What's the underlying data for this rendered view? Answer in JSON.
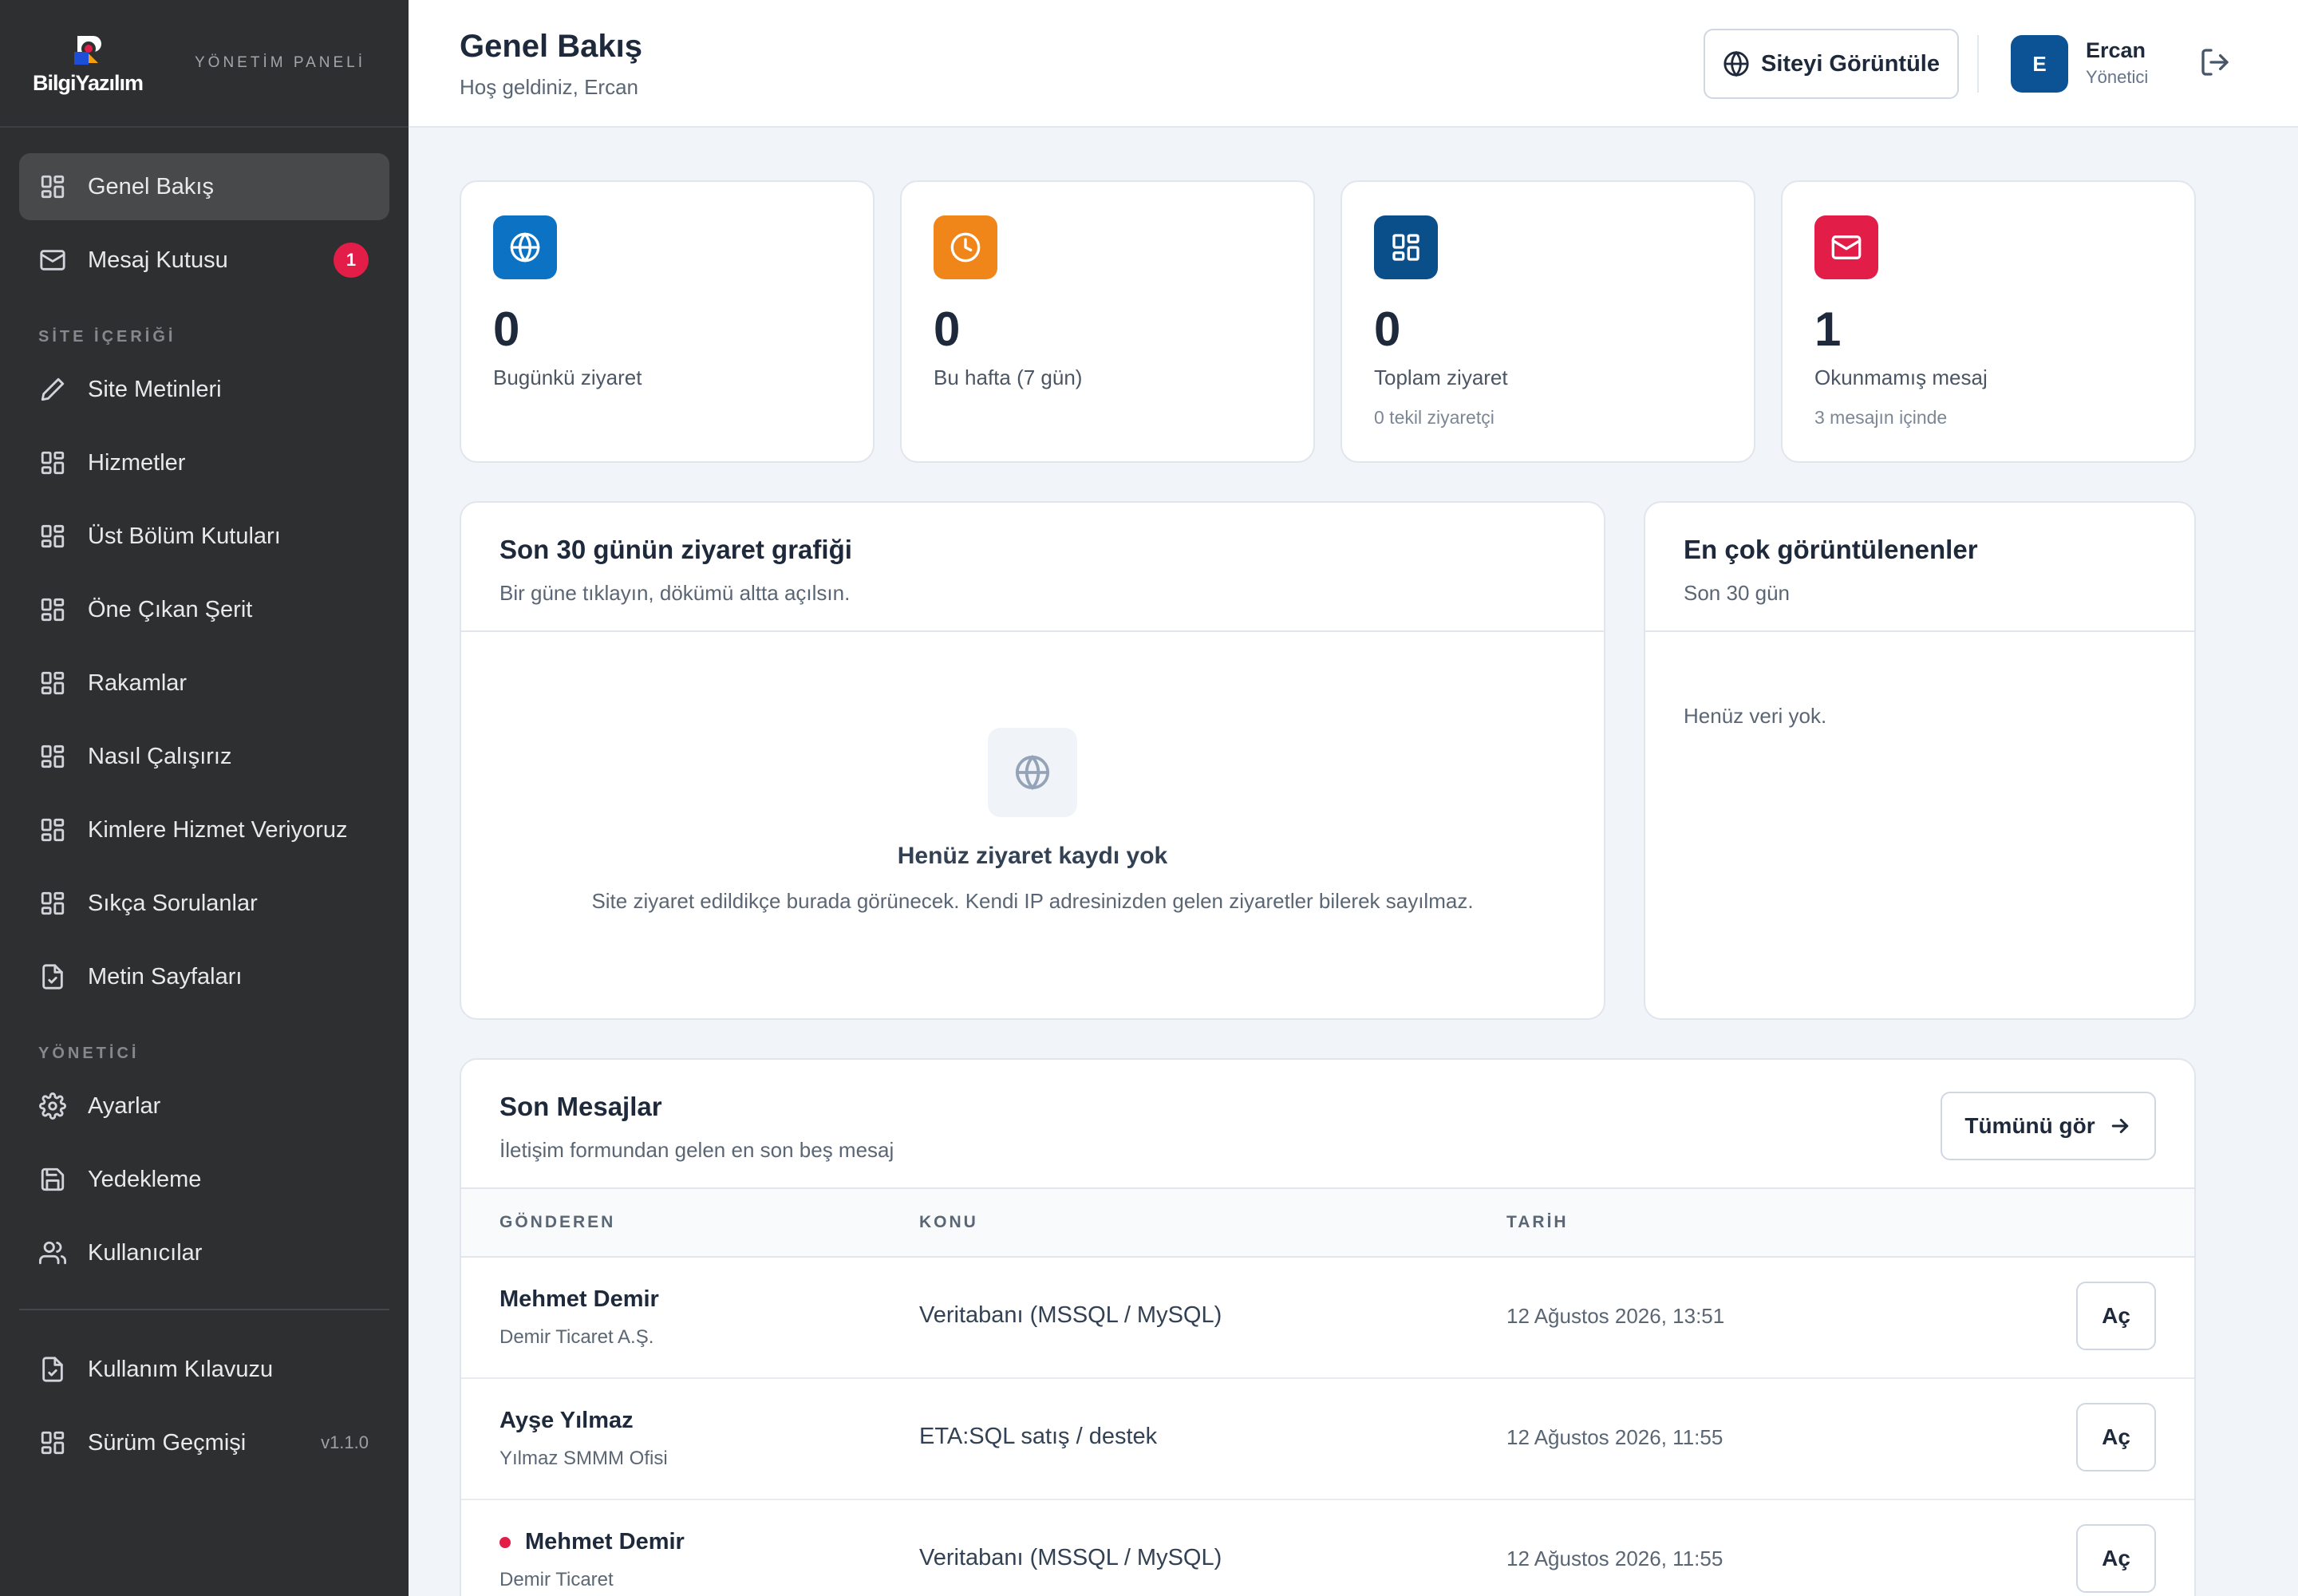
{
  "brand": {
    "logo_text": "BilgiYazılım",
    "panel_label": "YÖNETİM PANELİ"
  },
  "sidebar": {
    "items_top": [
      {
        "label": "Genel Bakış",
        "icon": "grid-icon",
        "active": true
      },
      {
        "label": "Mesaj Kutusu",
        "icon": "mail-icon",
        "badge": "1"
      }
    ],
    "section_content": "SİTE İÇERİĞİ",
    "items_content": [
      {
        "label": "Site Metinleri",
        "icon": "pencil-icon"
      },
      {
        "label": "Hizmetler",
        "icon": "grid-icon"
      },
      {
        "label": "Üst Bölüm Kutuları",
        "icon": "grid-icon"
      },
      {
        "label": "Öne Çıkan Şerit",
        "icon": "grid-icon"
      },
      {
        "label": "Rakamlar",
        "icon": "grid-icon"
      },
      {
        "label": "Nasıl Çalışırız",
        "icon": "grid-icon"
      },
      {
        "label": "Kimlere Hizmet Veriyoruz",
        "icon": "grid-icon"
      },
      {
        "label": "Sıkça Sorulanlar",
        "icon": "grid-icon"
      },
      {
        "label": "Metin Sayfaları",
        "icon": "file-check-icon"
      }
    ],
    "section_admin": "YÖNETİCİ",
    "items_admin": [
      {
        "label": "Ayarlar",
        "icon": "gear-icon"
      },
      {
        "label": "Yedekleme",
        "icon": "save-icon"
      },
      {
        "label": "Kullanıcılar",
        "icon": "users-icon"
      }
    ],
    "items_bottom": [
      {
        "label": "Kullanım Kılavuzu",
        "icon": "file-check-icon"
      },
      {
        "label": "Sürüm Geçmişi",
        "icon": "grid-icon",
        "version": "v1.1.0"
      }
    ]
  },
  "header": {
    "title": "Genel Bakış",
    "subtitle": "Hoş geldiniz, Ercan",
    "view_site_label": "Siteyi Görüntüle",
    "user": {
      "initial": "E",
      "name": "Ercan",
      "role": "Yönetici"
    }
  },
  "stats": [
    {
      "value": "0",
      "label": "Bugünkü ziyaret",
      "hint": "",
      "icon": "globe-icon",
      "color": "#0b72c4"
    },
    {
      "value": "0",
      "label": "Bu hafta (7 gün)",
      "hint": "",
      "icon": "clock-icon",
      "color": "#f0861a"
    },
    {
      "value": "0",
      "label": "Toplam ziyaret",
      "hint": "0 tekil ziyaretçi",
      "icon": "grid-icon",
      "color": "#0b4f8a"
    },
    {
      "value": "1",
      "label": "Okunmamış mesaj",
      "hint": "3 mesajın içinde",
      "icon": "mail-icon",
      "color": "#e11d48"
    }
  ],
  "visits_chart": {
    "title": "Son 30 günün ziyaret grafiği",
    "subtitle": "Bir güne tıklayın, dökümü altta açılsın.",
    "empty_title": "Henüz ziyaret kaydı yok",
    "empty_text": "Site ziyaret edildikçe burada görünecek. Kendi IP adresinizden gelen ziyaretler bilerek sayılmaz."
  },
  "most_viewed": {
    "title": "En çok görüntülenenler",
    "subtitle": "Son 30 gün",
    "empty_text": "Henüz veri yok."
  },
  "messages": {
    "title": "Son Mesajlar",
    "subtitle": "İletişim formundan gelen en son beş mesaj",
    "see_all_label": "Tümünü gör",
    "columns": [
      "GÖNDEREN",
      "KONU",
      "TARİH"
    ],
    "open_label": "Aç",
    "rows": [
      {
        "name": "Mehmet Demir",
        "company": "Demir Ticaret A.Ş.",
        "subject": "Veritabanı (MSSQL / MySQL)",
        "date": "12 Ağustos 2026, 13:51",
        "unread": false
      },
      {
        "name": "Ayşe Yılmaz",
        "company": "Yılmaz SMMM Ofisi",
        "subject": "ETA:SQL satış / destek",
        "date": "12 Ağustos 2026, 11:55",
        "unread": false
      },
      {
        "name": "Mehmet Demir",
        "company": "Demir Ticaret",
        "subject": "Veritabanı (MSSQL / MySQL)",
        "date": "12 Ağustos 2026, 11:55",
        "unread": true
      }
    ]
  }
}
